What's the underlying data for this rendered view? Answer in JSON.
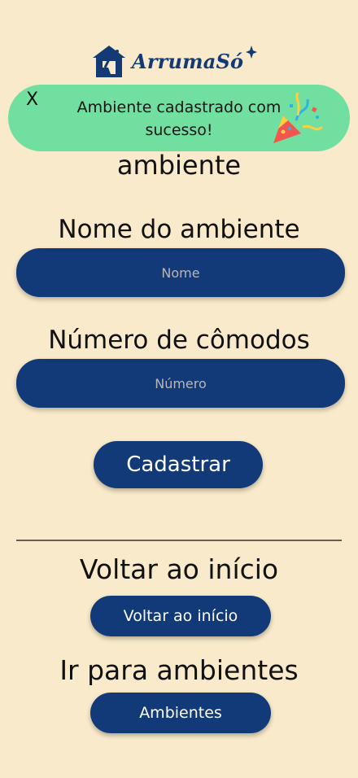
{
  "brand": {
    "name": "ArrumaSó",
    "color": "#143a75"
  },
  "toast": {
    "close_label": "X",
    "message": "Ambiente cadastrado com sucesso!",
    "icon": "party-popper-icon",
    "background": "#70df9f"
  },
  "page": {
    "title_partial": "ambiente"
  },
  "form": {
    "name_label": "Nome do ambiente",
    "name_placeholder": "Nome",
    "rooms_label": "Número de cômodos",
    "rooms_placeholder": "Número",
    "submit_label": "Cadastrar"
  },
  "nav": {
    "home_heading": "Voltar ao início",
    "home_button": "Voltar ao início",
    "envs_heading": "Ir para ambientes",
    "envs_button": "Ambientes"
  },
  "colors": {
    "background": "#f8eaca",
    "primary": "#123a79",
    "divider": "#6b5e4f"
  }
}
